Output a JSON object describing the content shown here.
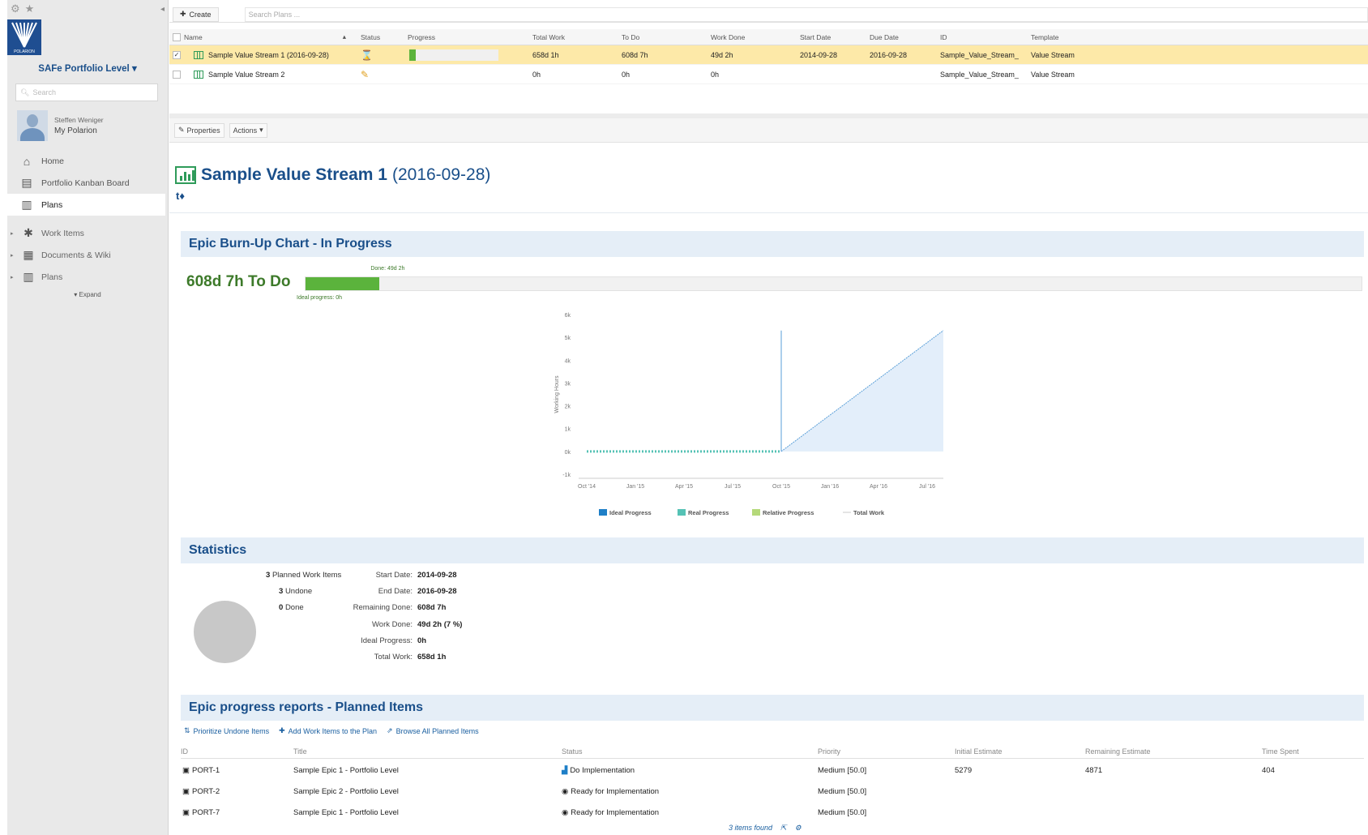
{
  "sidebar": {
    "project_title": "SAFe Portfolio Level",
    "logo_text": "POLARION",
    "search_placeholder": "Search",
    "user_name": "Steffen Weniger",
    "user_link": "My Polarion",
    "nav_items": [
      {
        "label": "Home",
        "icon": "home-icon"
      },
      {
        "label": "Portfolio Kanban Board",
        "icon": "document-icon"
      },
      {
        "label": "Plans",
        "icon": "plans-icon"
      }
    ],
    "sections": [
      {
        "label": "Work Items",
        "icon": "work-items-icon"
      },
      {
        "label": "Documents & Wiki",
        "icon": "documents-icon"
      },
      {
        "label": "Plans",
        "icon": "plans-icon"
      }
    ],
    "expand_label": "Expand"
  },
  "toolbar": {
    "create_label": "Create",
    "search_placeholder": "Search Plans ..."
  },
  "grid": {
    "columns": [
      "Name",
      "Status",
      "Progress",
      "Total Work",
      "To Do",
      "Work Done",
      "Start Date",
      "Due Date",
      "ID",
      "Template"
    ],
    "rows": [
      {
        "name": "Sample Value Stream 1 (2016-09-28)",
        "status_icon": "hourglass-icon",
        "progress": 0.07,
        "total_work": "658d 1h",
        "to_do": "608d 7h",
        "work_done": "49d 2h",
        "start_date": "2014-09-28",
        "due_date": "2016-09-28",
        "id": "Sample_Value_Stream_",
        "template": "Value Stream",
        "checked": "✓"
      },
      {
        "name": "Sample Value Stream 2",
        "status_icon": "pencil-icon",
        "progress": null,
        "total_work": "0h",
        "to_do": "0h",
        "work_done": "0h",
        "start_date": "",
        "due_date": "",
        "id": "Sample_Value_Stream_",
        "template": "Value Stream",
        "checked": ""
      }
    ]
  },
  "properties_bar": {
    "properties_label": "Properties",
    "actions_label": "Actions"
  },
  "plan": {
    "title": "Sample Value Stream 1",
    "date": "(2016-09-28)"
  },
  "burnup": {
    "section_title": "Epic Burn-Up Chart - In Progress",
    "todo_label": "608d 7h To Do",
    "done_label": "Done: 49d 2h",
    "ideal_label": "Ideal progress: 0h",
    "done_fraction": 0.07
  },
  "chart_data": {
    "type": "area",
    "ylabel": "Working Hours",
    "x_ticks": [
      "Oct '14",
      "Jan '15",
      "Apr '15",
      "Jul '15",
      "Oct '15",
      "Jan '16",
      "Apr '16",
      "Jul '16"
    ],
    "y_ticks": [
      "-1k",
      "0k",
      "1k",
      "2k",
      "3k",
      "4k",
      "5k",
      "6k"
    ],
    "ylim": [
      -1,
      6
    ],
    "legend": [
      "Ideal Progress",
      "Real Progress",
      "Relative Progress",
      "Total Work"
    ],
    "legend_colors": [
      "#1e7fc7",
      "#55c2b5",
      "#b5d97a",
      "#c8c8c8"
    ],
    "series": [
      {
        "name": "Real Progress",
        "points": [
          [
            "Oct '14",
            0
          ],
          [
            "Oct '15",
            0
          ]
        ]
      },
      {
        "name": "Ideal Progress",
        "points": [
          [
            "Oct '15",
            0
          ],
          [
            "Aug '16",
            5.3
          ]
        ]
      },
      {
        "name": "Total Work",
        "points": [
          [
            "Oct '15",
            5.3
          ]
        ]
      }
    ]
  },
  "statistics": {
    "section_title": "Statistics",
    "planned": {
      "count": "3",
      "label": "Planned Work Items"
    },
    "undone": {
      "count": "3",
      "label": "Undone"
    },
    "done": {
      "count": "0",
      "label": "Done"
    },
    "details": [
      {
        "key": "Start Date:",
        "value": "2014-09-28"
      },
      {
        "key": "End Date:",
        "value": "2016-09-28"
      },
      {
        "key": "Remaining Done:",
        "value": "608d 7h"
      },
      {
        "key": "Work Done:",
        "value": "49d 2h (7 %)"
      },
      {
        "key": "Ideal Progress:",
        "value": "0h"
      },
      {
        "key": "Total Work:",
        "value": "658d 1h"
      }
    ]
  },
  "epics": {
    "section_title": "Epic progress reports - Planned Items",
    "links": [
      "Prioritize Undone Items",
      "Add Work Items to the Plan",
      "Browse All Planned Items"
    ],
    "columns": [
      "ID",
      "Title",
      "Status",
      "Priority",
      "Initial Estimate",
      "Remaining Estimate",
      "Time Spent"
    ],
    "rows": [
      {
        "id": "PORT-1",
        "title": "Sample Epic 1 - Portfolio Level",
        "status": "Do Implementation",
        "priority": "Medium [50.0]",
        "initial": "5279",
        "remaining": "4871",
        "spent": "404"
      },
      {
        "id": "PORT-2",
        "title": "Sample Epic 2 - Portfolio Level",
        "status": "Ready for Implementation",
        "priority": "Medium [50.0]",
        "initial": "",
        "remaining": "",
        "spent": ""
      },
      {
        "id": "PORT-7",
        "title": "Sample Epic 1 - Portfolio Level",
        "status": "Ready for Implementation",
        "priority": "Medium [50.0]",
        "initial": "",
        "remaining": "",
        "spent": ""
      }
    ],
    "footer": "3 items found"
  }
}
